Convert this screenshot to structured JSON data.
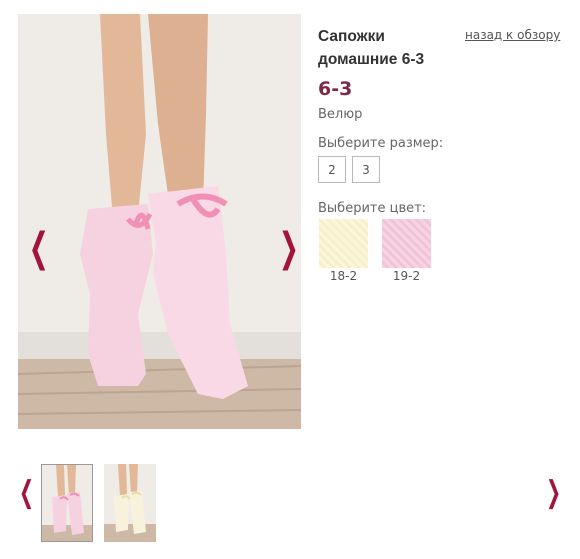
{
  "product": {
    "title": "Сапожки домашние 6-3",
    "code": "6-3",
    "material": "Велюр",
    "back_link": "назад к обзору"
  },
  "sizes": {
    "label": "Выберите размер:",
    "options": [
      "2",
      "3"
    ]
  },
  "colors": {
    "label": "Выберите цвет:",
    "options": [
      {
        "code": "18-2",
        "swatch": "#fbf6dc"
      },
      {
        "code": "19-2",
        "swatch": "#f7d4e3"
      }
    ]
  },
  "gallery": {
    "prev_glyph": "❮",
    "next_glyph": "❯",
    "thumbnails": [
      "pink-slippers-thumb",
      "cream-slippers-thumb"
    ]
  },
  "theme": {
    "accent": "#a3143d",
    "code_color": "#7d2a48"
  }
}
